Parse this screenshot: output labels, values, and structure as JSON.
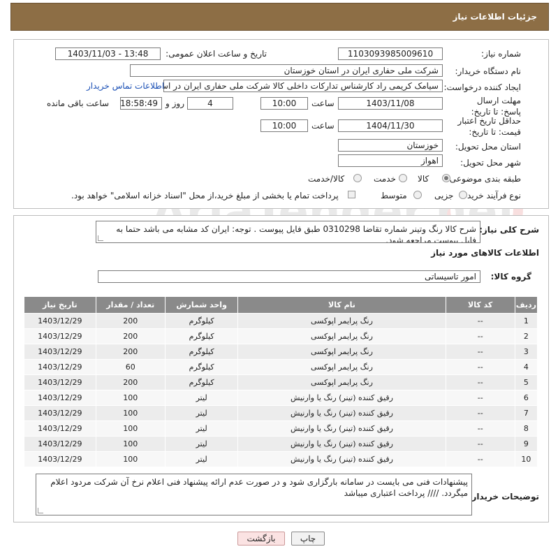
{
  "header": {
    "title": "جزئیات اطلاعات نیاز"
  },
  "form": {
    "need_number_label": "شماره نیاز:",
    "need_number": "1103093985009610",
    "announce_label": "تاریخ و ساعت اعلان عمومی:",
    "announce_value": "1403/11/03 - 13:48",
    "buyer_label": "نام دستگاه خریدار:",
    "buyer_value": "شرکت ملی حفاری ایران در استان خوزستان",
    "creator_label": "ایجاد کننده درخواست:",
    "creator_value": "سیامک کریمی راد کارشناس تدارکات داخلی کالا شرکت ملی حفاری ایران در اس",
    "contact_link": "اطلاعات تماس خریدار",
    "deadline_label": "مهلت ارسال پاسخ: تا تاریخ:",
    "deadline_date": "1403/11/08",
    "time_label": "ساعت",
    "deadline_time": "10:00",
    "days_value": "4",
    "days_label": "روز و",
    "remaining_time": "18:58:49",
    "remaining_label": "ساعت باقی مانده",
    "validity_label": "حداقل تاریخ اعتبار قیمت: تا تاریخ:",
    "validity_date": "1404/11/30",
    "validity_time": "10:00",
    "province_label": "استان محل تحویل:",
    "province_value": "خوزستان",
    "city_label": "شهر محل تحویل:",
    "city_value": "اهواز",
    "category_label": "طبقه بندی موضوعی:",
    "category_options": [
      "کالا",
      "خدمت",
      "کالا/خدمت"
    ],
    "process_label": "نوع فرآیند خرید :",
    "process_options": [
      "جزیی",
      "متوسط"
    ],
    "payment_note": "پرداخت تمام یا بخشی از مبلغ خرید،از محل \"اسناد خزانه اسلامی\" خواهد بود."
  },
  "description": {
    "label": "شرح کلی نیاز:",
    "text": "شرح کالا رنگ وتینر شماره تقاضا 0310298 طبق فایل پیوست . توجه: ایران کد مشابه می باشد حتما به فایل پیوست مراجعه شود."
  },
  "goods_section": {
    "title": "اطلاعات کالاهای مورد نیاز",
    "group_label": "گروه کالا:",
    "group_value": "امور تاسیساتی"
  },
  "table": {
    "headers": [
      "ردیف",
      "کد کالا",
      "نام کالا",
      "واحد شمارش",
      "تعداد / مقدار",
      "تاریخ نیاز"
    ],
    "rows": [
      [
        "1",
        "--",
        "رنگ پرایمر اپوکسی",
        "کیلوگرم",
        "200",
        "1403/12/29"
      ],
      [
        "2",
        "--",
        "رنگ پرایمر اپوکسی",
        "کیلوگرم",
        "200",
        "1403/12/29"
      ],
      [
        "3",
        "--",
        "رنگ پرایمر اپوکسی",
        "کیلوگرم",
        "200",
        "1403/12/29"
      ],
      [
        "4",
        "--",
        "رنگ پرایمر اپوکسی",
        "کیلوگرم",
        "60",
        "1403/12/29"
      ],
      [
        "5",
        "--",
        "رنگ پرایمر اپوکسی",
        "کیلوگرم",
        "200",
        "1403/12/29"
      ],
      [
        "6",
        "--",
        "رقیق کننده (تینر) رنگ یا وارنیش",
        "لیتر",
        "100",
        "1403/12/29"
      ],
      [
        "7",
        "--",
        "رقیق کننده (تینر) رنگ یا وارنیش",
        "لیتر",
        "100",
        "1403/12/29"
      ],
      [
        "8",
        "--",
        "رقیق کننده (تینر) رنگ یا وارنیش",
        "لیتر",
        "100",
        "1403/12/29"
      ],
      [
        "9",
        "--",
        "رقیق کننده (تینر) رنگ یا وارنیش",
        "لیتر",
        "100",
        "1403/12/29"
      ],
      [
        "10",
        "--",
        "رقیق کننده (تینر) رنگ یا وارنیش",
        "لیتر",
        "100",
        "1403/12/29"
      ]
    ]
  },
  "buyer_notes": {
    "label": "توضیحات خریدار:",
    "text": "پیشنهادات فنی می بایست در سامانه بارگزاری شود و در صورت عدم ارائه پیشنهاد فنی اعلام نرخ آن شرکت مردود اعلام میگردد.  //// پرداخت اعتباری میباشد"
  },
  "buttons": {
    "print": "چاپ",
    "back": "بازگشت"
  },
  "watermark": {
    "text": "AriaTender.net"
  },
  "colors": {
    "header": "#8d6e45",
    "table_header": "#8a8a8a",
    "link": "#1a4fb5"
  }
}
